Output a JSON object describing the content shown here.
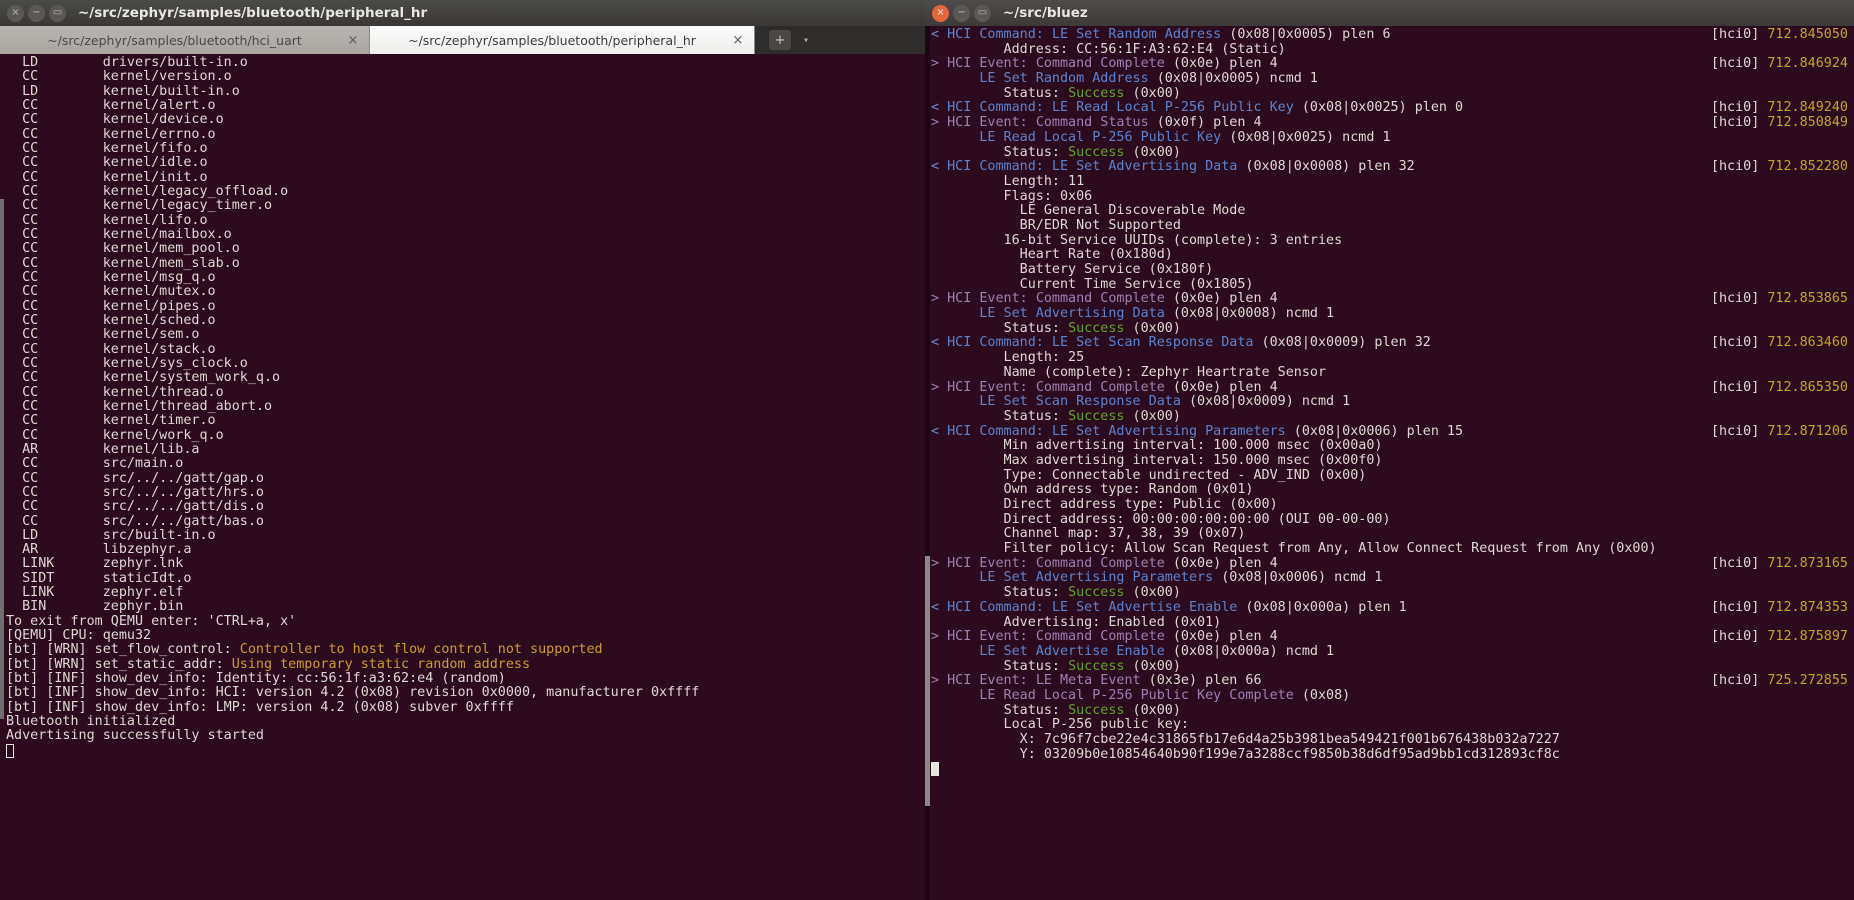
{
  "left_window": {
    "title": "~/src/zephyr/samples/bluetooth/peripheral_hr",
    "window_buttons": {
      "close": "×",
      "minimize": "−",
      "maximize": "▭"
    },
    "tabs": [
      {
        "label": "~/src/zephyr/samples/bluetooth/hci_uart",
        "active": false,
        "close": "×"
      },
      {
        "label": "~/src/zephyr/samples/bluetooth/peripheral_hr",
        "active": true,
        "close": "×"
      }
    ],
    "new_tab_label": "+",
    "tab_menu_label": "▾",
    "build_lines": [
      {
        "action": "LD",
        "target": "drivers/built-in.o"
      },
      {
        "action": "CC",
        "target": "kernel/version.o"
      },
      {
        "action": "LD",
        "target": "kernel/built-in.o"
      },
      {
        "action": "CC",
        "target": "kernel/alert.o"
      },
      {
        "action": "CC",
        "target": "kernel/device.o"
      },
      {
        "action": "CC",
        "target": "kernel/errno.o"
      },
      {
        "action": "CC",
        "target": "kernel/fifo.o"
      },
      {
        "action": "CC",
        "target": "kernel/idle.o"
      },
      {
        "action": "CC",
        "target": "kernel/init.o"
      },
      {
        "action": "CC",
        "target": "kernel/legacy_offload.o"
      },
      {
        "action": "CC",
        "target": "kernel/legacy_timer.o"
      },
      {
        "action": "CC",
        "target": "kernel/lifo.o"
      },
      {
        "action": "CC",
        "target": "kernel/mailbox.o"
      },
      {
        "action": "CC",
        "target": "kernel/mem_pool.o"
      },
      {
        "action": "CC",
        "target": "kernel/mem_slab.o"
      },
      {
        "action": "CC",
        "target": "kernel/msg_q.o"
      },
      {
        "action": "CC",
        "target": "kernel/mutex.o"
      },
      {
        "action": "CC",
        "target": "kernel/pipes.o"
      },
      {
        "action": "CC",
        "target": "kernel/sched.o"
      },
      {
        "action": "CC",
        "target": "kernel/sem.o"
      },
      {
        "action": "CC",
        "target": "kernel/stack.o"
      },
      {
        "action": "CC",
        "target": "kernel/sys_clock.o"
      },
      {
        "action": "CC",
        "target": "kernel/system_work_q.o"
      },
      {
        "action": "CC",
        "target": "kernel/thread.o"
      },
      {
        "action": "CC",
        "target": "kernel/thread_abort.o"
      },
      {
        "action": "CC",
        "target": "kernel/timer.o"
      },
      {
        "action": "CC",
        "target": "kernel/work_q.o"
      },
      {
        "action": "AR",
        "target": "kernel/lib.a"
      },
      {
        "action": "CC",
        "target": "src/main.o"
      },
      {
        "action": "CC",
        "target": "src/../../gatt/gap.o"
      },
      {
        "action": "CC",
        "target": "src/../../gatt/hrs.o"
      },
      {
        "action": "CC",
        "target": "src/../../gatt/dis.o"
      },
      {
        "action": "CC",
        "target": "src/../../gatt/bas.o"
      },
      {
        "action": "LD",
        "target": "src/built-in.o"
      },
      {
        "action": "AR",
        "target": "libzephyr.a"
      },
      {
        "action": "LINK",
        "target": "zephyr.lnk"
      },
      {
        "action": "SIDT",
        "target": "staticIdt.o"
      },
      {
        "action": "LINK",
        "target": "zephyr.elf"
      },
      {
        "action": "BIN",
        "target": "zephyr.bin"
      }
    ],
    "runtime_lines": [
      {
        "text": "To exit from QEMU enter: 'CTRL+a, x'",
        "color": "plain"
      },
      {
        "text": "[QEMU] CPU: qemu32",
        "color": "plain"
      },
      {
        "prefix": "[bt] [WRN] set_flow_control: ",
        "text": "Controller to host flow control not supported",
        "color": "warn"
      },
      {
        "prefix": "[bt] [WRN] set_static_addr: ",
        "text": "Using temporary static random address",
        "color": "warn"
      },
      {
        "text": "[bt] [INF] show_dev_info: Identity: cc:56:1f:a3:62:e4 (random)",
        "color": "plain"
      },
      {
        "text": "[bt] [INF] show_dev_info: HCI: version 4.2 (0x08) revision 0x0000, manufacturer 0xffff",
        "color": "plain"
      },
      {
        "text": "[bt] [INF] show_dev_info: LMP: version 4.2 (0x08) subver 0xffff",
        "color": "plain"
      },
      {
        "text": "Bluetooth initialized",
        "color": "plain"
      },
      {
        "text": "Advertising successfully started",
        "color": "plain"
      }
    ]
  },
  "right_window": {
    "title": "~/src/bluez",
    "window_buttons": {
      "close": "×",
      "minimize": "−",
      "maximize": "▭"
    },
    "hci_device": "[hci0]",
    "log": [
      {
        "dir": "<",
        "kind": "cmd",
        "label": "HCI Command: ",
        "name": "LE Set Random Address",
        "tail": " (0x08|0x0005) plen 6",
        "ts": "712.845050"
      },
      {
        "indent": 9,
        "text": "Address: CC:56:1F:A3:62:E4 (Static)"
      },
      {
        "dir": ">",
        "kind": "evt",
        "label": "HCI Event: ",
        "name": "Command Complete",
        "tail": " (0x0e) plen 4",
        "ts": "712.846924"
      },
      {
        "indent": 6,
        "kind": "cmd",
        "name": "LE Set Random Address",
        "tail": " (0x08|0x0005) ncmd 1"
      },
      {
        "indent": 9,
        "text": "Status: ",
        "ok": "Success",
        "after": " (0x00)"
      },
      {
        "dir": "<",
        "kind": "cmd",
        "label": "HCI Command: ",
        "name": "LE Read Local P-256 Public Key",
        "tail": " (0x08|0x0025) plen 0",
        "ts": "712.849240"
      },
      {
        "dir": ">",
        "kind": "evt",
        "label": "HCI Event: ",
        "name": "Command Status",
        "tail": " (0x0f) plen 4",
        "ts": "712.850849"
      },
      {
        "indent": 6,
        "kind": "cmd",
        "name": "LE Read Local P-256 Public Key",
        "tail": " (0x08|0x0025) ncmd 1"
      },
      {
        "indent": 9,
        "text": "Status: ",
        "ok": "Success",
        "after": " (0x00)"
      },
      {
        "dir": "<",
        "kind": "cmd",
        "label": "HCI Command: ",
        "name": "LE Set Advertising Data",
        "tail": " (0x08|0x0008) plen 32",
        "ts": "712.852280"
      },
      {
        "indent": 9,
        "text": "Length: 11"
      },
      {
        "indent": 9,
        "text": "Flags: 0x06"
      },
      {
        "indent": 11,
        "text": "LE General Discoverable Mode"
      },
      {
        "indent": 11,
        "text": "BR/EDR Not Supported"
      },
      {
        "indent": 9,
        "text": "16-bit Service UUIDs (complete): 3 entries"
      },
      {
        "indent": 11,
        "text": "Heart Rate (0x180d)"
      },
      {
        "indent": 11,
        "text": "Battery Service (0x180f)"
      },
      {
        "indent": 11,
        "text": "Current Time Service (0x1805)"
      },
      {
        "dir": ">",
        "kind": "evt",
        "label": "HCI Event: ",
        "name": "Command Complete",
        "tail": " (0x0e) plen 4",
        "ts": "712.853865"
      },
      {
        "indent": 6,
        "kind": "cmd",
        "name": "LE Set Advertising Data",
        "tail": " (0x08|0x0008) ncmd 1"
      },
      {
        "indent": 9,
        "text": "Status: ",
        "ok": "Success",
        "after": " (0x00)"
      },
      {
        "dir": "<",
        "kind": "cmd",
        "label": "HCI Command: ",
        "name": "LE Set Scan Response Data",
        "tail": " (0x08|0x0009) plen 32",
        "ts": "712.863460"
      },
      {
        "indent": 9,
        "text": "Length: 25"
      },
      {
        "indent": 9,
        "text": "Name (complete): Zephyr Heartrate Sensor"
      },
      {
        "dir": ">",
        "kind": "evt",
        "label": "HCI Event: ",
        "name": "Command Complete",
        "tail": " (0x0e) plen 4",
        "ts": "712.865350"
      },
      {
        "indent": 6,
        "kind": "cmd",
        "name": "LE Set Scan Response Data",
        "tail": " (0x08|0x0009) ncmd 1"
      },
      {
        "indent": 9,
        "text": "Status: ",
        "ok": "Success",
        "after": " (0x00)"
      },
      {
        "dir": "<",
        "kind": "cmd",
        "label": "HCI Command: ",
        "name": "LE Set Advertising Parameters",
        "tail": " (0x08|0x0006) plen 15",
        "ts": "712.871206"
      },
      {
        "indent": 9,
        "text": "Min advertising interval: 100.000 msec (0x00a0)"
      },
      {
        "indent": 9,
        "text": "Max advertising interval: 150.000 msec (0x00f0)"
      },
      {
        "indent": 9,
        "text": "Type: Connectable undirected - ADV_IND (0x00)"
      },
      {
        "indent": 9,
        "text": "Own address type: Random (0x01)"
      },
      {
        "indent": 9,
        "text": "Direct address type: Public (0x00)"
      },
      {
        "indent": 9,
        "text": "Direct address: 00:00:00:00:00:00 (OUI 00-00-00)"
      },
      {
        "indent": 9,
        "text": "Channel map: 37, 38, 39 (0x07)"
      },
      {
        "indent": 9,
        "text": "Filter policy: Allow Scan Request from Any, Allow Connect Request from Any (0x00)"
      },
      {
        "dir": ">",
        "kind": "evt",
        "label": "HCI Event: ",
        "name": "Command Complete",
        "tail": " (0x0e) plen 4",
        "ts": "712.873165"
      },
      {
        "indent": 6,
        "kind": "cmd",
        "name": "LE Set Advertising Parameters",
        "tail": " (0x08|0x0006) ncmd 1"
      },
      {
        "indent": 9,
        "text": "Status: ",
        "ok": "Success",
        "after": " (0x00)"
      },
      {
        "dir": "<",
        "kind": "cmd",
        "label": "HCI Command: ",
        "name": "LE Set Advertise Enable",
        "tail": " (0x08|0x000a) plen 1",
        "ts": "712.874353"
      },
      {
        "indent": 9,
        "text": "Advertising: Enabled (0x01)"
      },
      {
        "dir": ">",
        "kind": "evt",
        "label": "HCI Event: ",
        "name": "Command Complete",
        "tail": " (0x0e) plen 4",
        "ts": "712.875897"
      },
      {
        "indent": 6,
        "kind": "cmd",
        "name": "LE Set Advertise Enable",
        "tail": " (0x08|0x000a) ncmd 1"
      },
      {
        "indent": 9,
        "text": "Status: ",
        "ok": "Success",
        "after": " (0x00)"
      },
      {
        "dir": ">",
        "kind": "evt",
        "label": "HCI Event: ",
        "name": "LE Meta Event",
        "tail": " (0x3e) plen 66",
        "ts": "725.272855"
      },
      {
        "indent": 6,
        "kind": "evt",
        "name": "LE Read Local P-256 Public Key Complete",
        "tail": " (0x08)"
      },
      {
        "indent": 9,
        "text": "Status: ",
        "ok": "Success",
        "after": " (0x00)"
      },
      {
        "indent": 9,
        "text": "Local P-256 public key:"
      },
      {
        "indent": 11,
        "text": "X: 7c96f7cbe22e4c31865fb17e6d4a25b3981bea549421f001b676438b032a7227"
      },
      {
        "indent": 11,
        "text": "Y: 03209b0e10854640b90f199e7a3288ccf9850b38d6df95ad9bb1cd312893cf8c"
      }
    ]
  },
  "colors": {
    "terminal_bg": "#2c0b1e",
    "titlebar_bg": "#3c3a38",
    "accent_close": "#e2663a",
    "timestamp": "#c7a227",
    "success": "#5fa32b",
    "warning": "#cf9a2d",
    "command": "#5b82cf",
    "event": "#9d7fb4"
  }
}
